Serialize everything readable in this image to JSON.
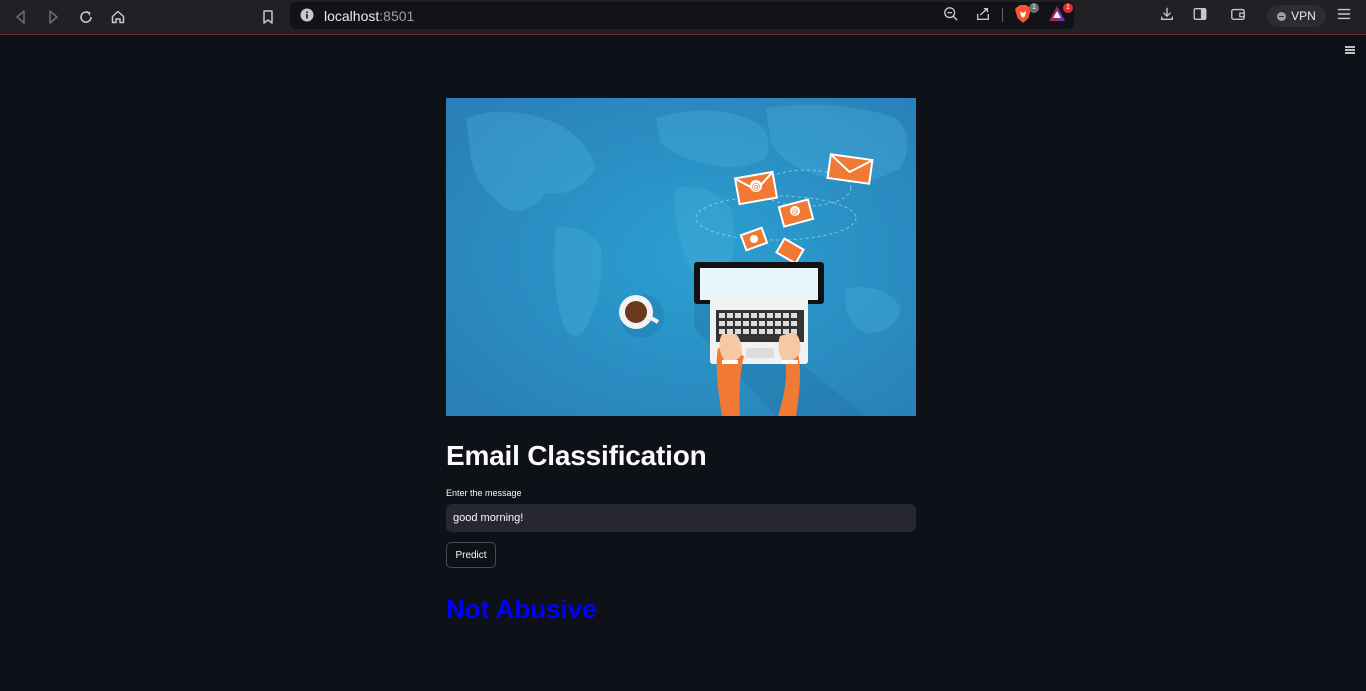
{
  "browser": {
    "url_host": "localhost",
    "url_port": ":8501",
    "brave_shield_count": "1",
    "rewards_count": "1",
    "vpn_label": "VPN"
  },
  "app": {
    "title": "Email Classification",
    "input": {
      "label": "Enter the message",
      "value": "good morning!"
    },
    "predict_label": "Predict",
    "result_text": "Not Abusive",
    "result_color": "#0000ff"
  },
  "colors": {
    "background": "#0e1117",
    "input_bg": "#262730",
    "hero_bg": "#2e8cc4"
  }
}
